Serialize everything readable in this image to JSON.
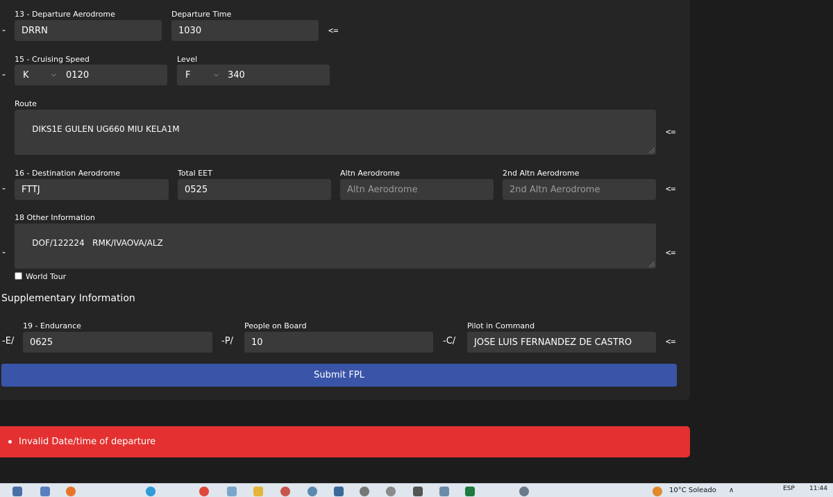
{
  "fields": {
    "departure_aerodrome": {
      "label": "13 - Departure Aerodrome",
      "value": "DRRN"
    },
    "departure_time": {
      "label": "Departure Time",
      "value": "1030"
    },
    "cruising_speed": {
      "label": "15 - Cruising Speed",
      "unit": "K",
      "value": "0120"
    },
    "level": {
      "label": "Level",
      "unit": "F",
      "value": "340"
    },
    "route": {
      "label": "Route",
      "value": "DIKS1E GULEN UG660 MIU KELA1M"
    },
    "destination": {
      "label": "16 - Destination Aerodrome",
      "value": "FTTJ"
    },
    "total_eet": {
      "label": "Total EET",
      "value": "0525"
    },
    "altn": {
      "label": "Altn Aerodrome",
      "placeholder": "Altn Aerodrome"
    },
    "altn2": {
      "label": "2nd Altn Aerodrome",
      "placeholder": "2nd Altn Aerodrome"
    },
    "other_info": {
      "label": "18 Other Information",
      "value": "DOF/122224   RMK/IVAOVA/ALZ"
    },
    "world_tour": {
      "label": "World Tour",
      "checked": false
    }
  },
  "supplementary": {
    "title": "Supplementary Information",
    "endurance": {
      "prefix": "-E/",
      "label": "19 - Endurance",
      "value": "0625"
    },
    "people": {
      "prefix": "-P/",
      "label": "People on Board",
      "value": "10"
    },
    "pilot": {
      "prefix": "-C/",
      "label": "Pilot in Command",
      "value": "JOSE LUIS FERNANDEZ DE CASTRO"
    }
  },
  "symbols": {
    "dash": "-",
    "arrow": "<="
  },
  "submit_label": "Submit FPL",
  "error": {
    "message": "Invalid Date/time of departure"
  },
  "taskbar": {
    "weather": "10°C  Soleado",
    "lang": "ESP",
    "time": "11:44"
  },
  "colors": {
    "panel": "#252525",
    "input": "#3a3a3a",
    "submit": "#3a55a8",
    "error": "#e43030"
  }
}
